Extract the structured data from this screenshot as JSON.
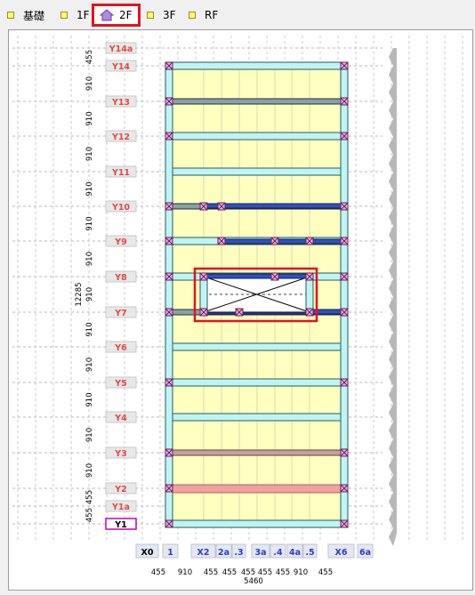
{
  "tabs": [
    {
      "label": "基礎",
      "active": false
    },
    {
      "label": "1F",
      "active": false
    },
    {
      "label": "2F",
      "active": true
    },
    {
      "label": "3F",
      "active": false
    },
    {
      "label": "RF",
      "active": false
    }
  ],
  "y_grid": [
    {
      "label": "Y14a",
      "dim": "455"
    },
    {
      "label": "Y14",
      "dim": "910"
    },
    {
      "label": "Y13",
      "dim": "910"
    },
    {
      "label": "Y12",
      "dim": "910"
    },
    {
      "label": "Y11",
      "dim": "910"
    },
    {
      "label": "Y10",
      "dim": "910"
    },
    {
      "label": "Y9",
      "dim": "910"
    },
    {
      "label": "Y8",
      "dim": "910"
    },
    {
      "label": "Y7",
      "dim": "910"
    },
    {
      "label": "Y6",
      "dim": "910"
    },
    {
      "label": "Y5",
      "dim": "910"
    },
    {
      "label": "Y4",
      "dim": "910"
    },
    {
      "label": "Y3",
      "dim": "910"
    },
    {
      "label": "Y2",
      "dim": "455"
    },
    {
      "label": "Y1a",
      "dim": "455"
    },
    {
      "label": "Y1",
      "dim": ""
    }
  ],
  "y_total": "12285",
  "x_grid": [
    "X0",
    "1",
    "X2",
    "2a",
    ".3",
    "3a",
    ".4",
    "4a",
    ".5",
    "X6",
    "6a"
  ],
  "x_dims": [
    "455",
    "910",
    "455",
    "455",
    "455",
    "455",
    "455",
    "910",
    "455"
  ],
  "x_total": "5460",
  "colors": {
    "floor": "#ffffc0",
    "beam": "#bff4f4",
    "grid_label": "#e04848",
    "x_label": "#2a3cc8",
    "highlight": "#e0141e"
  }
}
